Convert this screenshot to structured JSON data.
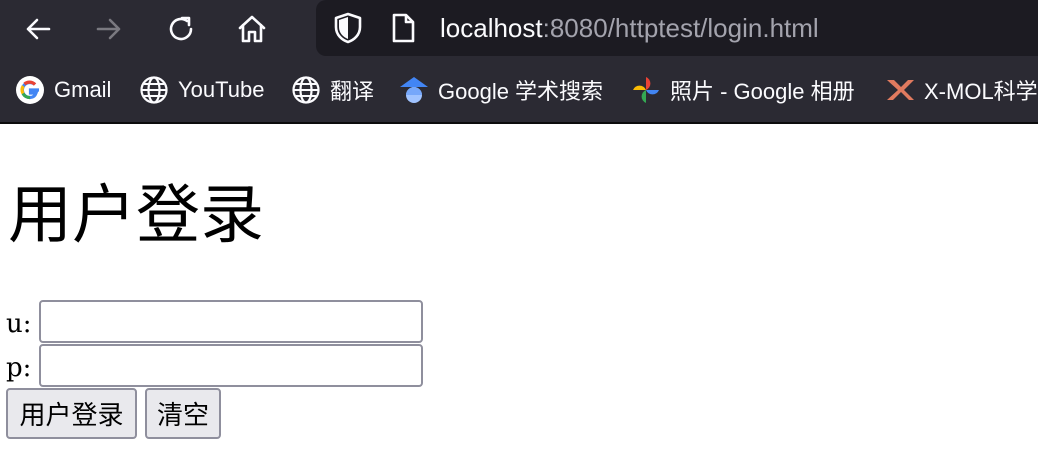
{
  "browser": {
    "url_host": "localhost",
    "url_rest": ":8080/httptest/login.html",
    "icons": {
      "back": "arrow-left-icon",
      "forward": "arrow-right-icon",
      "reload": "reload-icon",
      "home": "home-icon",
      "tracking_protection": "shield-icon",
      "page_info": "page-icon"
    },
    "forward_disabled": true
  },
  "bookmarks": [
    {
      "label": "Gmail",
      "icon": "google-g-icon"
    },
    {
      "label": "YouTube",
      "icon": "globe-icon"
    },
    {
      "label": "翻译",
      "icon": "globe-icon"
    },
    {
      "label": "Google 学术搜索",
      "icon": "google-scholar-icon"
    },
    {
      "label": "照片 - Google 相册",
      "icon": "google-photos-icon"
    },
    {
      "label": "X-MOL科学",
      "icon": "xmol-icon"
    }
  ],
  "page": {
    "title": "用户登录",
    "username_label": "u:",
    "password_label": "p:",
    "username_value": "",
    "password_value": "",
    "login_button": "用户登录",
    "clear_button": "清空"
  },
  "colors": {
    "toolbar_bg": "#2b2a33",
    "urlbar_bg": "#1c1b22",
    "input_border": "#8f8f9d",
    "button_bg": "#e9e9ed"
  }
}
